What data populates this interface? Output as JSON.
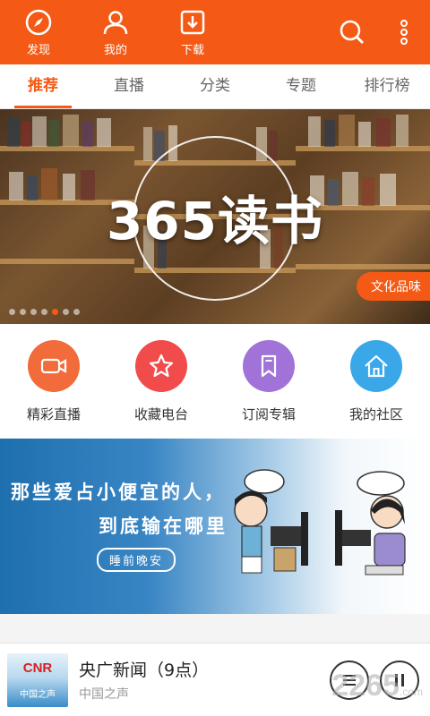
{
  "topbar": {
    "nav": [
      {
        "label": "发现",
        "icon": "compass-icon"
      },
      {
        "label": "我的",
        "icon": "user-icon"
      },
      {
        "label": "下载",
        "icon": "download-icon"
      }
    ],
    "right_icons": [
      "search-icon",
      "more-vertical-icon"
    ],
    "color": "#f45a16"
  },
  "tabs": [
    {
      "label": "推荐",
      "active": true
    },
    {
      "label": "直播",
      "active": false
    },
    {
      "label": "分类",
      "active": false
    },
    {
      "label": "专题",
      "active": false
    },
    {
      "label": "排行榜",
      "active": false
    }
  ],
  "banner": {
    "title": "365读书",
    "tag": "文化品味",
    "dots_total": 7,
    "dot_active_index": 4
  },
  "quick_actions": [
    {
      "label": "精彩直播",
      "icon": "video-camera-icon",
      "color": "#f26b3a"
    },
    {
      "label": "收藏电台",
      "icon": "star-icon",
      "color": "#f14b4b"
    },
    {
      "label": "订阅专辑",
      "icon": "bookmark-icon",
      "color": "#a173d8"
    },
    {
      "label": "我的社区",
      "icon": "home-icon",
      "color": "#3aa8e8"
    }
  ],
  "promo": {
    "line1": "那些爱占小便宜的人，",
    "line2": "到底输在哪里",
    "badge": "睡前晚安"
  },
  "player": {
    "title": "央广新闻（9点）",
    "station": "中国之声",
    "cover_brand": "CNR",
    "cover_sub": "中国之声"
  },
  "watermark": {
    "text": "2265",
    "suffix": ".com"
  }
}
